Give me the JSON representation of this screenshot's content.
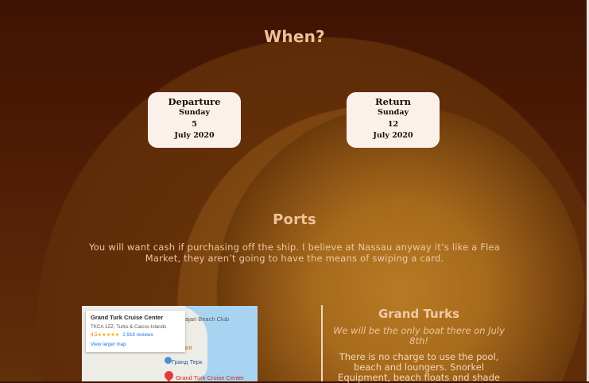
{
  "when": {
    "title": "When?",
    "departure": {
      "label": "Departure",
      "day": "Sunday",
      "date": "5",
      "month_year": "July 2020"
    },
    "return": {
      "label": "Return",
      "day": "Sunday",
      "date": "12",
      "month_year": "July 2020"
    }
  },
  "ports": {
    "title": "Ports",
    "description": "You will want cash if purchasing off the ship. I believe at Nassau anyway it’s like a Flea Market, they aren’t going to have the means of swiping a card."
  },
  "map": {
    "place_name": "Grand Turk Cruise Center",
    "address": "TKCA 1ZZ, Turks & Caicos Islands",
    "rating": "4.5",
    "stars": "★★★★★",
    "reviews": "2,919 reviews",
    "larger_map_link": "View larger map",
    "label_beach": "ajari Beach Club",
    "label_restaurant": "taurant",
    "label_grand": "Гранд Терк",
    "label_pin": "Grand Turk Cruise Center",
    "icons": [
      "location-pin-icon",
      "poi-icon"
    ]
  },
  "port_detail": {
    "title": "Grand Turks",
    "note": "We will be the only boat there on July 8th!",
    "text": "There is no charge to use the pool, beach and loungers. Snorkel Equipment, beach floats and shade"
  },
  "colors": {
    "heading": "#f1c196",
    "card_bg": "#fbf1ea",
    "background_dark": "#3f1303",
    "background_glow": "#b87a24"
  }
}
